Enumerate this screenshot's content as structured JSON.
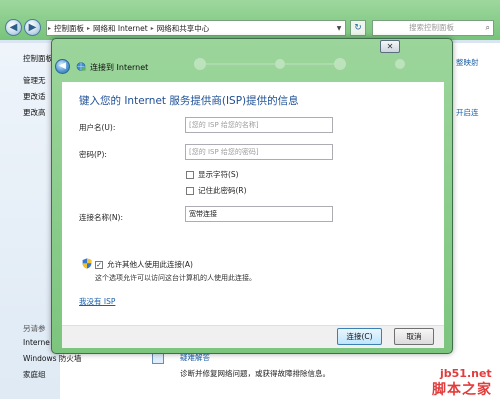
{
  "explorer": {
    "breadcrumbs": [
      "控制面板",
      "网络和 Internet",
      "网络和共享中心"
    ],
    "search_placeholder": "搜索控制面板",
    "left_pane": {
      "items": [
        "控制面板",
        "管理无",
        "更改适",
        "更改高"
      ],
      "see_also_header": "另请参",
      "see_also": [
        "Interne",
        "Windows 防火墙",
        "家庭组"
      ]
    },
    "right_links": [
      "整映射",
      "开启连"
    ],
    "troubleshoot_title": "疑难解答",
    "troubleshoot_desc": "诊断并修复网络问题，或获得故障排除信息。"
  },
  "dialog": {
    "title": "连接到 Internet",
    "close_label": "✕",
    "heading": "键入您的 Internet 服务提供商(ISP)提供的信息",
    "username_label": "用户名(U):",
    "username_placeholder": "[您的 ISP 给您的名称]",
    "password_label": "密码(P):",
    "password_placeholder": "[您的 ISP 给您的密码]",
    "show_chars_label": "显示字符(S)",
    "show_chars_checked": false,
    "remember_label": "记住此密码(R)",
    "remember_checked": false,
    "connection_name_label": "连接名称(N):",
    "connection_name_value": "宽带连接",
    "allow_others_label": "允许其他人使用此连接(A)",
    "allow_others_checked": true,
    "allow_others_note": "这个选项允许可以访问这台计算机的人使用此连接。",
    "no_isp_link": "我没有 ISP",
    "connect_button": "连接(C)",
    "cancel_button": "取消"
  },
  "watermark": {
    "line1": "jb51.net",
    "line2": "脚本之家"
  },
  "colors": {
    "aero_green": "#7cc57e",
    "heading_blue": "#1e4f96",
    "link_blue": "#1a5faa",
    "watermark_red": "#e23c3c"
  }
}
